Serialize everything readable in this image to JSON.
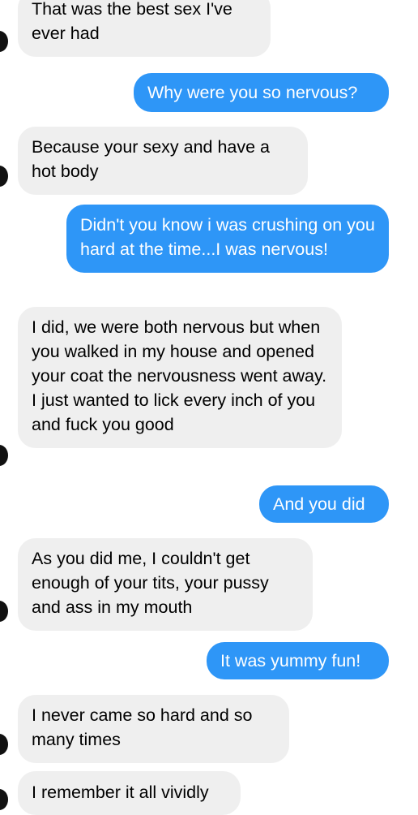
{
  "conversation": {
    "messages": [
      {
        "side": "incoming",
        "text": "That was the best sex I've ever had"
      },
      {
        "side": "outgoing",
        "text": "Why were you so nervous?"
      },
      {
        "side": "incoming",
        "text": "Because your sexy and have a hot body"
      },
      {
        "side": "outgoing",
        "text": "Didn't you know i was crushing on you hard at the time...I was nervous!"
      },
      {
        "side": "incoming",
        "text": "I did, we were both nervous but when you walked in my house and opened your coat the nervousness went away. I just wanted to lick every inch of you and fuck you good"
      },
      {
        "side": "outgoing",
        "text": "And you did"
      },
      {
        "side": "incoming",
        "text": "As you did me, I couldn't get enough of your tits, your pussy and ass in my mouth"
      },
      {
        "side": "outgoing",
        "text": "It was yummy fun!"
      },
      {
        "side": "incoming",
        "text": "I never came so hard and so many times"
      },
      {
        "side": "incoming",
        "text": "I remember it all vividly"
      }
    ]
  },
  "colors": {
    "incoming_bubble": "#efefef",
    "outgoing_bubble": "#2e96f7",
    "incoming_text": "#000000",
    "outgoing_text": "#ffffff",
    "avatar": "#111111"
  }
}
